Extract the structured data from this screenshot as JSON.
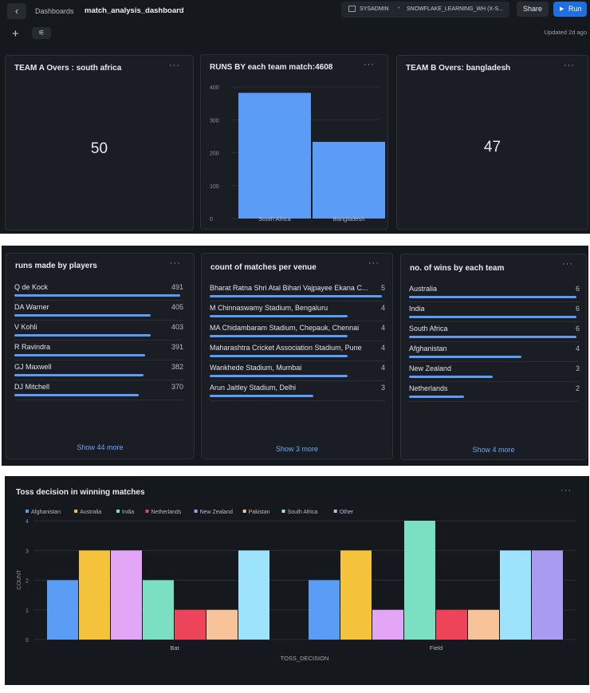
{
  "topbar": {
    "breadcrumb": "Dashboards",
    "dashboard_name": "match_analysis_dashboard",
    "role": "SYSADMIN",
    "warehouse": "SNOWFLAKE_LEARNING_WH (X-S...",
    "share_label": "Share",
    "run_label": "Run",
    "updated": "Updated 2d ago"
  },
  "tiles": {
    "team_a": {
      "title": "TEAM A Overs : south africa",
      "value": "50"
    },
    "runs_chart": {
      "title": "RUNS BY each team match:4608"
    },
    "team_b": {
      "title": "TEAM B Overs: bangladesh",
      "value": "47"
    },
    "players": {
      "title": "runs made by players",
      "rows": [
        {
          "name": "Q de Kock",
          "value": "491",
          "fraction": 1.0
        },
        {
          "name": "DA Warner",
          "value": "405",
          "fraction": 0.82
        },
        {
          "name": "V Kohli",
          "value": "403",
          "fraction": 0.82
        },
        {
          "name": "R Ravindra",
          "value": "391",
          "fraction": 0.79
        },
        {
          "name": "GJ Maxwell",
          "value": "382",
          "fraction": 0.78
        },
        {
          "name": "DJ Mitchell",
          "value": "370",
          "fraction": 0.75
        }
      ],
      "show_more": "Show 44 more"
    },
    "venues": {
      "title": "count of matches per venue",
      "rows": [
        {
          "name": "Bharat Ratna Shri Atal Bihari Vajpayee Ekana C...",
          "value": "5",
          "fraction": 1.0
        },
        {
          "name": "M Chinnaswamy Stadium, Bengaluru",
          "value": "4",
          "fraction": 0.8
        },
        {
          "name": "MA Chidambaram Stadium, Chepauk, Chennai",
          "value": "4",
          "fraction": 0.8
        },
        {
          "name": "Maharashtra Cricket Association Stadium, Pune",
          "value": "4",
          "fraction": 0.8
        },
        {
          "name": "Wankhede Stadium, Mumbai",
          "value": "4",
          "fraction": 0.8
        },
        {
          "name": "Arun Jaitley Stadium, Delhi",
          "value": "3",
          "fraction": 0.6
        }
      ],
      "show_more": "Show 3 more"
    },
    "wins": {
      "title": "no. of wins by each team",
      "rows": [
        {
          "name": "Australia",
          "value": "6",
          "fraction": 1.0
        },
        {
          "name": "India",
          "value": "6",
          "fraction": 1.0
        },
        {
          "name": "South Africa",
          "value": "6",
          "fraction": 1.0
        },
        {
          "name": "Afghanistan",
          "value": "4",
          "fraction": 0.67
        },
        {
          "name": "New Zealand",
          "value": "3",
          "fraction": 0.5
        },
        {
          "name": "Netherlands",
          "value": "2",
          "fraction": 0.33
        }
      ],
      "show_more": "Show 4 more"
    },
    "toss": {
      "title": "Toss decision in winning matches"
    }
  },
  "menu_glyph": "···",
  "chart_data": [
    {
      "type": "bar",
      "title": "RUNS BY each team match:4608",
      "categories": [
        "South Africa",
        "Bangladesh"
      ],
      "values": [
        382,
        233
      ],
      "ylim": [
        0,
        400
      ],
      "yticks": [
        0,
        100,
        200,
        300,
        400
      ],
      "color": "#5b9cf6",
      "grid": true
    },
    {
      "type": "bar",
      "title": "Toss decision in winning matches",
      "xlabel": "TOSS_DECISION",
      "ylabel": "COUNT",
      "categories": [
        "Bat",
        "Field"
      ],
      "ylim": [
        0,
        4
      ],
      "yticks": [
        0,
        1,
        2,
        3,
        4
      ],
      "legend_position": "top-left",
      "grid": true,
      "series": [
        {
          "name": "Afghanistan",
          "color": "#5b9cf6",
          "values": [
            2,
            2
          ]
        },
        {
          "name": "Australia",
          "color": "#f5c33b",
          "values": [
            3,
            3
          ]
        },
        {
          "name": "India",
          "color": "#7be0c1",
          "values": [
            2,
            4
          ]
        },
        {
          "name": "Netherlands",
          "color": "#ee4459",
          "values": [
            1,
            1
          ]
        },
        {
          "name": "New Zealand",
          "color": "#a99cf0",
          "values": [
            null,
            3
          ]
        },
        {
          "name": "Pakistan",
          "color": "#f9c39a",
          "values": [
            1,
            1
          ]
        },
        {
          "name": "South Africa",
          "color": "#9de3fb",
          "values": [
            3,
            3
          ]
        },
        {
          "name": "Other",
          "color": "#e3a5f5",
          "values": [
            3,
            1
          ]
        }
      ],
      "bar_order": [
        [
          "Afghanistan",
          "Australia",
          "Other",
          "India",
          "Netherlands",
          "Pakistan",
          "South Africa"
        ],
        [
          "Afghanistan",
          "Australia",
          "Other",
          "India",
          "Netherlands",
          "Pakistan",
          "South Africa",
          "New Zealand"
        ]
      ]
    }
  ]
}
